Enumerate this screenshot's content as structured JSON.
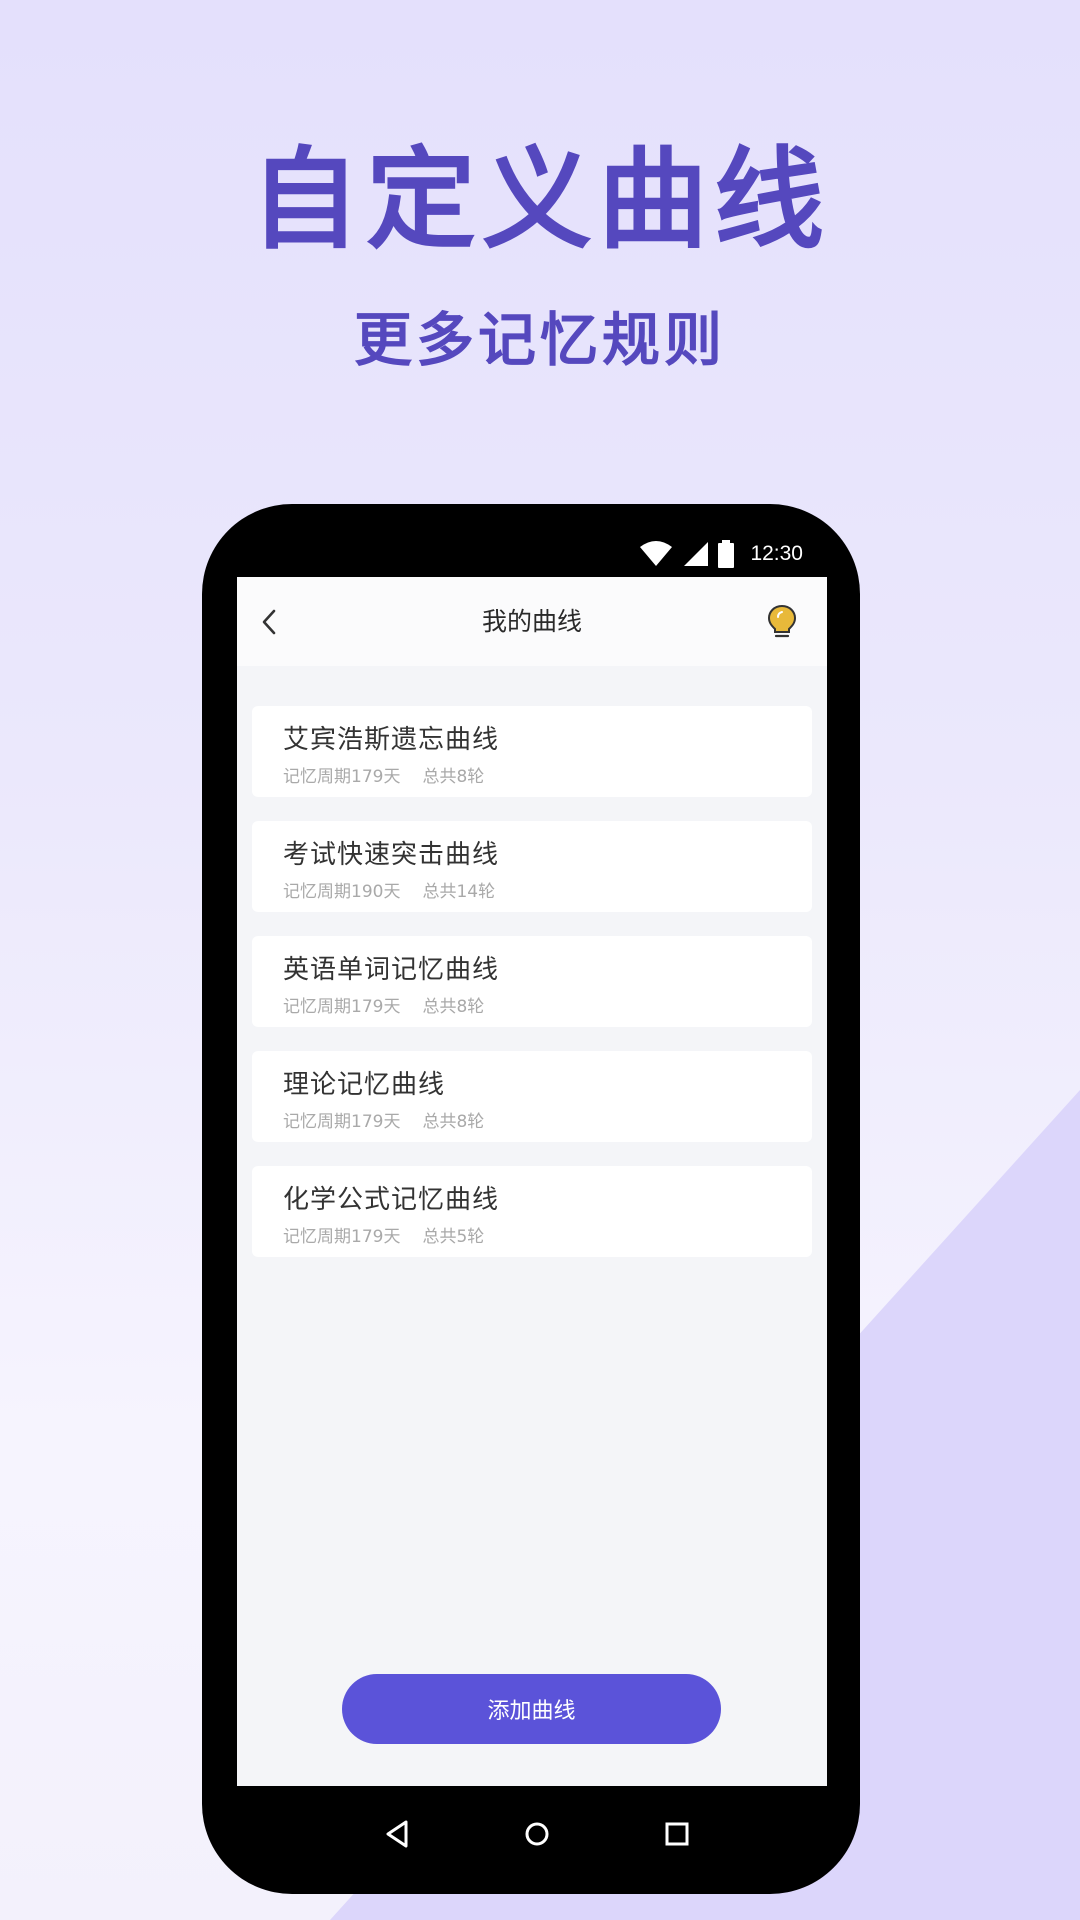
{
  "promo": {
    "headline": "自定义曲线",
    "subheadline": "更多记忆规则"
  },
  "colors": {
    "brand": "#5548be",
    "button": "#5b53d9",
    "bg_accent": "#dcd6fb",
    "bulb": "#e8b93a"
  },
  "status_bar": {
    "time": "12:30",
    "icons": [
      "wifi-icon",
      "cell-signal-icon",
      "battery-icon"
    ]
  },
  "app_bar": {
    "title": "我的曲线",
    "back_icon": "chevron-left-icon",
    "tip_icon": "lightbulb-icon"
  },
  "curves": [
    {
      "name": "艾宾浩斯遗忘曲线",
      "period": "记忆周期179天",
      "rounds": "总共8轮"
    },
    {
      "name": "考试快速突击曲线",
      "period": "记忆周期190天",
      "rounds": "总共14轮"
    },
    {
      "name": "英语单词记忆曲线",
      "period": "记忆周期179天",
      "rounds": "总共8轮"
    },
    {
      "name": "理论记忆曲线",
      "period": "记忆周期179天",
      "rounds": "总共8轮"
    },
    {
      "name": "化学公式记忆曲线",
      "period": "记忆周期179天",
      "rounds": "总共5轮"
    }
  ],
  "add_button": {
    "label": "添加曲线"
  },
  "nav_bar": {
    "icons": [
      "nav-back-icon",
      "nav-home-icon",
      "nav-recents-icon"
    ]
  }
}
